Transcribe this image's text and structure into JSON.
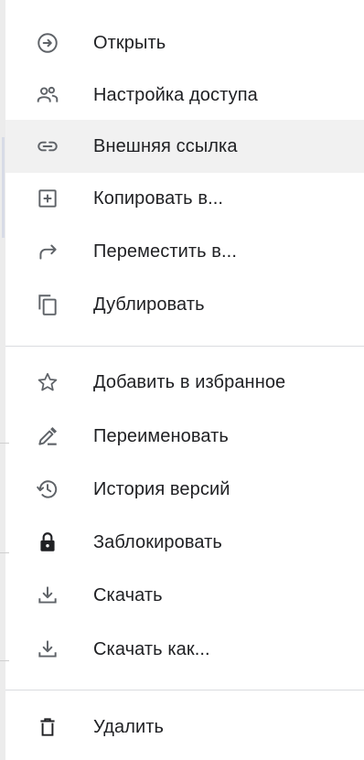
{
  "menu": {
    "items": [
      {
        "label": "Открыть",
        "icon": "open-with-icon"
      },
      {
        "label": "Настройка доступа",
        "icon": "share-people-icon"
      },
      {
        "label": "Внешняя ссылка",
        "icon": "link-icon"
      },
      {
        "label": "Копировать в...",
        "icon": "add-box-icon"
      },
      {
        "label": "Переместить в...",
        "icon": "move-arrow-icon"
      },
      {
        "label": "Дублировать",
        "icon": "duplicate-icon"
      },
      {
        "label": "Добавить в избранное",
        "icon": "star-outline-icon"
      },
      {
        "label": "Переименовать",
        "icon": "rename-pencil-icon"
      },
      {
        "label": "История версий",
        "icon": "history-icon"
      },
      {
        "label": "Заблокировать",
        "icon": "lock-icon"
      },
      {
        "label": "Скачать",
        "icon": "download-icon"
      },
      {
        "label": "Скачать как...",
        "icon": "download-as-icon"
      },
      {
        "label": "Удалить",
        "icon": "trash-icon"
      }
    ],
    "hovered_item": "Внешняя ссылка"
  },
  "colors": {
    "text": "#202124",
    "icon": "#5f6368",
    "hover_bg": "#f1f1f1",
    "divider": "#dadce0"
  }
}
